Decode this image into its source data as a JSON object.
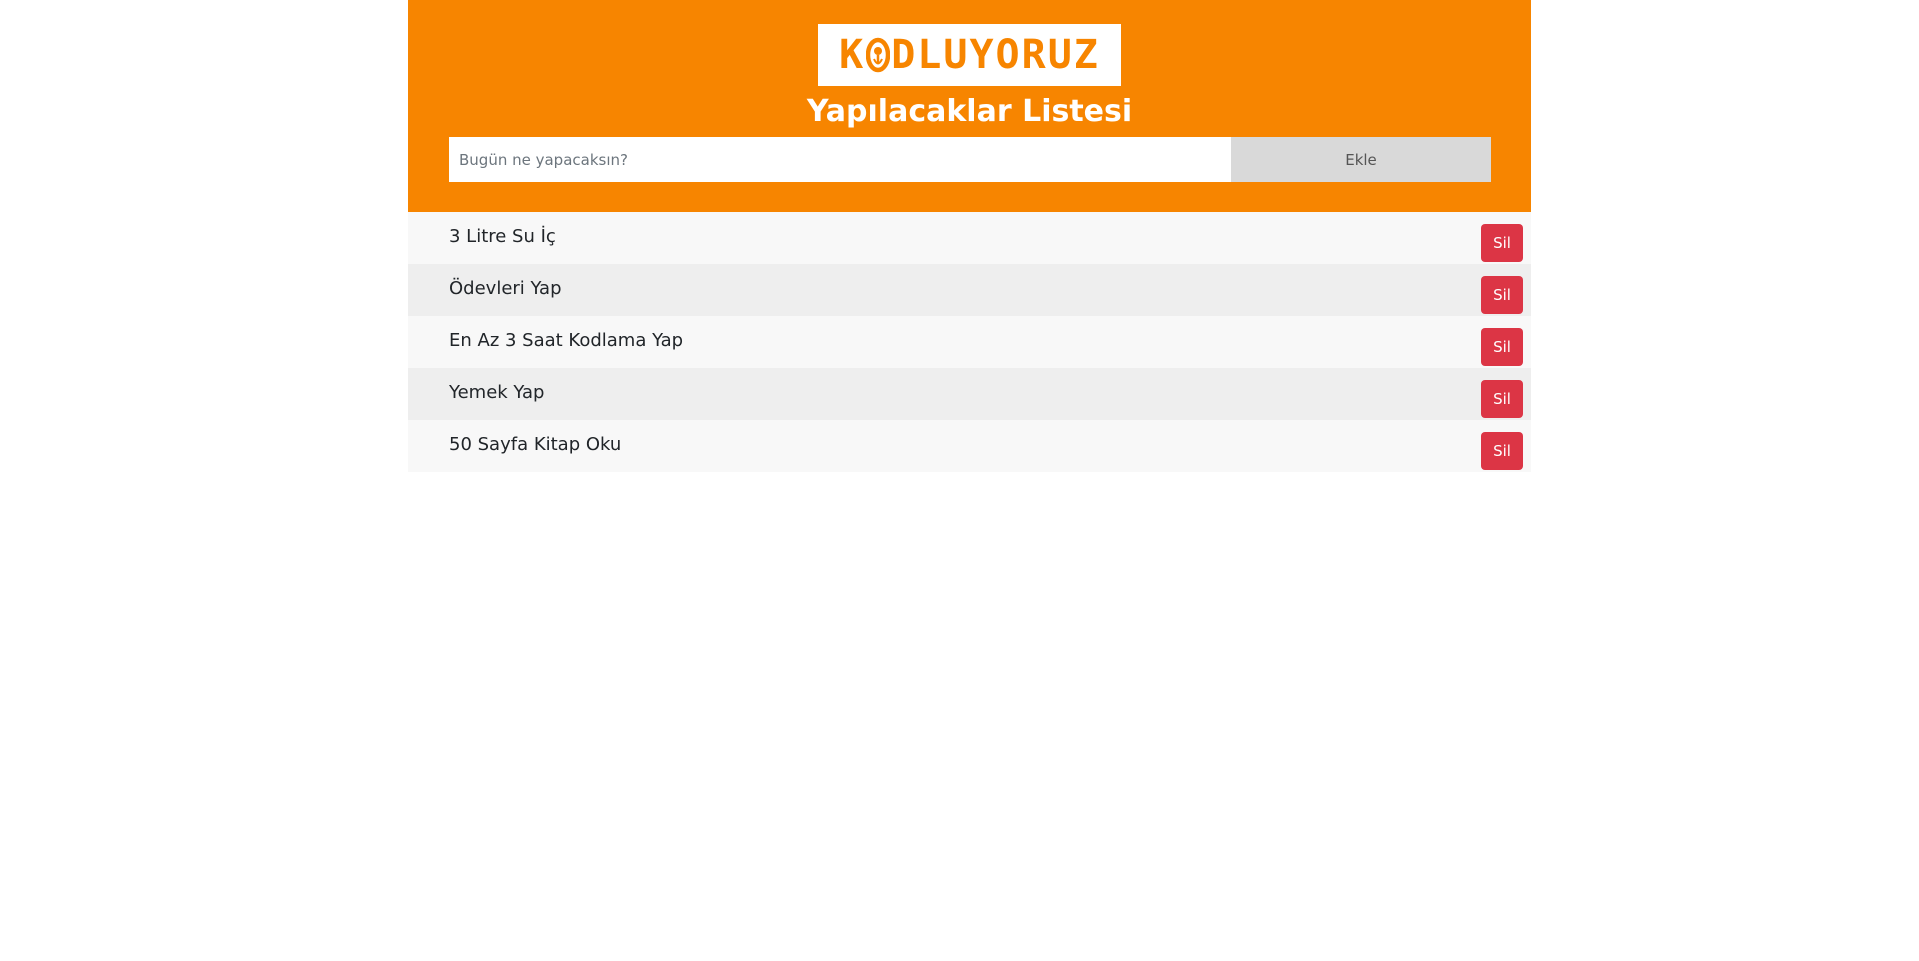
{
  "colors": {
    "brand": "#f78500",
    "header_text": "#ffffff",
    "delete_button": "#dc3545",
    "add_button": "#d9d9d9",
    "row_odd": "#f8f8f8",
    "row_even": "#eeeeee"
  },
  "logo": {
    "before_o": "K",
    "after_o": "DLUYORUZ",
    "icon": "lightbulb-o-icon"
  },
  "header": {
    "title": "Yapılacaklar Listesi"
  },
  "form": {
    "input_placeholder": "Bugün ne yapacaksın?",
    "input_value": "",
    "add_label": "Ekle"
  },
  "todos": [
    {
      "text": "3 Litre Su İç",
      "delete_label": "Sil"
    },
    {
      "text": "Ödevleri Yap",
      "delete_label": "Sil"
    },
    {
      "text": "En Az 3 Saat Kodlama Yap",
      "delete_label": "Sil"
    },
    {
      "text": "Yemek Yap",
      "delete_label": "Sil"
    },
    {
      "text": "50 Sayfa Kitap Oku",
      "delete_label": "Sil"
    }
  ]
}
